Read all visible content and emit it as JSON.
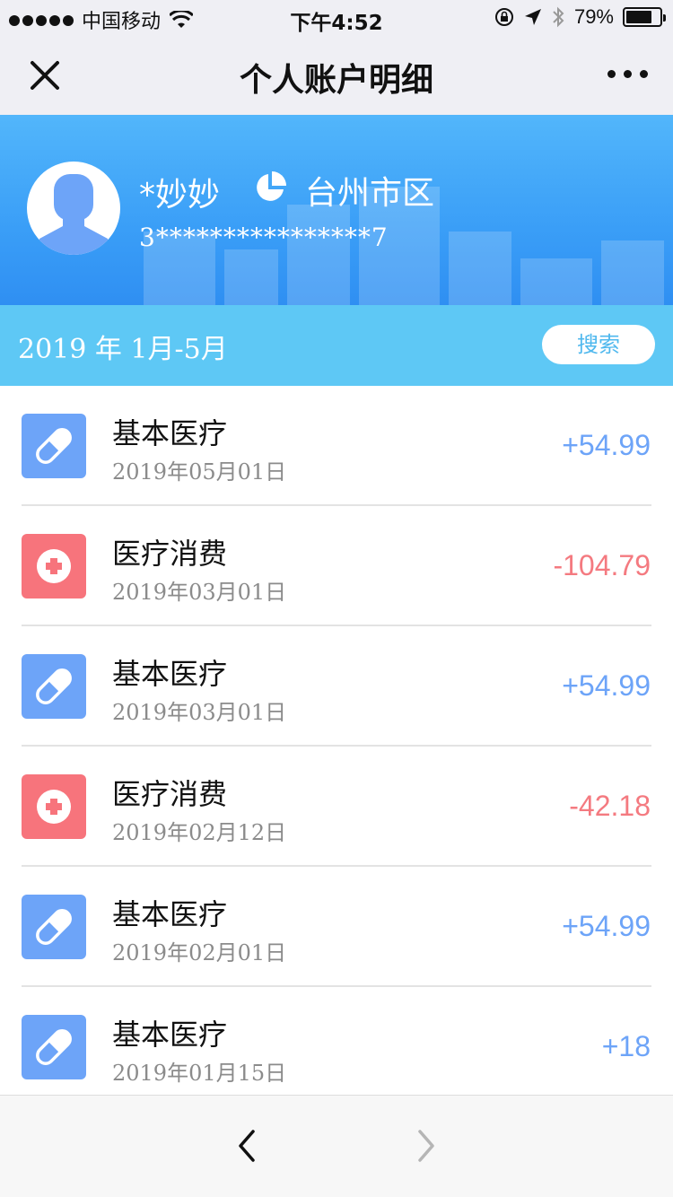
{
  "status": {
    "carrier": "中国移动",
    "time": "下午4:52",
    "battery": "79%",
    "battery_level": 0.79
  },
  "nav": {
    "title": "个人账户明细"
  },
  "profile": {
    "name": "*妙妙",
    "region": "台州市区",
    "id_masked": "3****************7"
  },
  "filter": {
    "range": "2019 年 1月-5月",
    "search_label": "搜索"
  },
  "records": [
    {
      "type": "基本医疗",
      "date": "2019年05月01日",
      "amount": "+54.99",
      "kind": "pill"
    },
    {
      "type": "医疗消费",
      "date": "2019年03月01日",
      "amount": "-104.79",
      "kind": "cross"
    },
    {
      "type": "基本医疗",
      "date": "2019年03月01日",
      "amount": "+54.99",
      "kind": "pill"
    },
    {
      "type": "医疗消费",
      "date": "2019年02月12日",
      "amount": "-42.18",
      "kind": "cross"
    },
    {
      "type": "基本医疗",
      "date": "2019年02月01日",
      "amount": "+54.99",
      "kind": "pill"
    },
    {
      "type": "基本医疗",
      "date": "2019年01月15日",
      "amount": "+18",
      "kind": "pill"
    }
  ],
  "colors": {
    "accent_blue": "#6da4f8",
    "accent_red": "#f47a80",
    "banner": "#3a9ef7",
    "filter_bar": "#5ec8f5"
  },
  "icons": {
    "close": "close-icon",
    "more": "more-icon",
    "pie": "pie-chart-icon",
    "pill": "pill-icon",
    "cross": "medical-cross-icon",
    "back": "chevron-left-icon",
    "forward": "chevron-right-icon"
  }
}
